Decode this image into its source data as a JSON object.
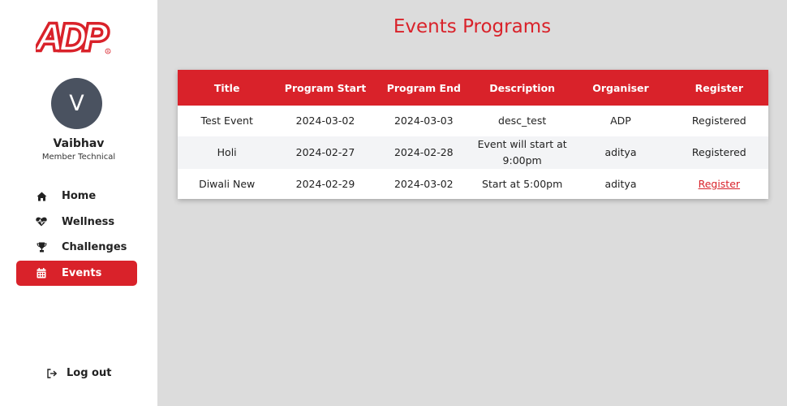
{
  "brand": {
    "logo_text": "ADP",
    "accent": "#d9222a"
  },
  "user": {
    "initial": "V",
    "name": "Vaibhav",
    "role": "Member Technical"
  },
  "nav": {
    "items": [
      {
        "label": "Home",
        "icon": "home-icon"
      },
      {
        "label": "Wellness",
        "icon": "heartbeat-icon"
      },
      {
        "label": "Challenges",
        "icon": "trophy-icon"
      },
      {
        "label": "Events",
        "icon": "calendar-icon",
        "active": true
      }
    ],
    "logout": {
      "label": "Log out",
      "icon": "logout-icon"
    }
  },
  "page": {
    "title": "Events Programs"
  },
  "table": {
    "headers": [
      "Title",
      "Program Start",
      "Program End",
      "Description",
      "Organiser",
      "Register"
    ],
    "rows": [
      {
        "title": "Test Event",
        "start": "2024-03-02",
        "end": "2024-03-03",
        "description_1": "desc_test",
        "description_2": "",
        "organiser": "ADP",
        "register": "Registered"
      },
      {
        "title": "Holi",
        "start": "2024-02-27",
        "end": "2024-02-28",
        "description_1": "Event will start at",
        "description_2": "9:00pm",
        "organiser": "aditya",
        "register": "Registered"
      },
      {
        "title": "Diwali New",
        "start": "2024-02-29",
        "end": "2024-03-02",
        "description_1": "Start at 5:00pm",
        "description_2": "",
        "organiser": "aditya",
        "register": "Register"
      }
    ]
  }
}
